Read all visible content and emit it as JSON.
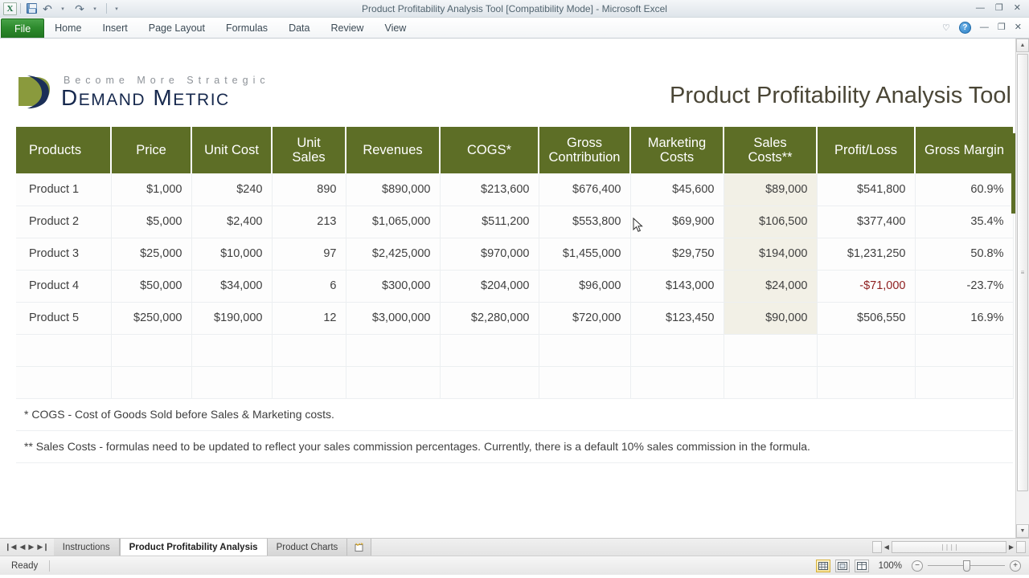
{
  "titlebar": {
    "document_title": "Product Profitability Analysis Tool  [Compatibility Mode]  -  Microsoft Excel",
    "excel_icon": "X",
    "save_icon": "save-icon",
    "undo_icon": "↶",
    "redo_icon": "↷",
    "caret": "▾",
    "minimize": "—",
    "restore": "❐",
    "close": "✕"
  },
  "ribbon": {
    "file_label": "File",
    "tabs": [
      {
        "label": "Home"
      },
      {
        "label": "Insert"
      },
      {
        "label": "Page Layout"
      },
      {
        "label": "Formulas"
      },
      {
        "label": "Data"
      },
      {
        "label": "Review"
      },
      {
        "label": "View"
      }
    ],
    "heart_icon": "♡",
    "help_icon": "?",
    "minimize_ribbon": "—",
    "restore_window": "❐",
    "close_window": "✕"
  },
  "document": {
    "logo": {
      "tagline": "Become More Strategic",
      "brand_part1": "D",
      "brand_rest1": "EMAND",
      "brand_part2": "M",
      "brand_rest2": "ETRIC",
      "mark_green": "#8a9a3d",
      "mark_navy": "#1b2f57"
    },
    "title": "Product Profitability Analysis Tool",
    "accent_green": "#5d6e26",
    "tint_cream": "#f2f0e6",
    "negative_color": "#8f2020"
  },
  "table": {
    "headers": [
      "Products",
      "Price",
      "Unit Cost",
      "Unit Sales",
      "Revenues",
      "COGS*",
      "Gross Contribution",
      "Marketing Costs",
      "Sales Costs**",
      "Profit/Loss",
      "Gross Margin"
    ],
    "rows": [
      {
        "product": "Product 1",
        "price": "$1,000",
        "unit_cost": "$240",
        "unit_sales": "890",
        "revenues": "$890,000",
        "cogs": "$213,600",
        "gross_contribution": "$676,400",
        "marketing_costs": "$45,600",
        "sales_costs": "$89,000",
        "profit_loss": "$541,800",
        "gross_margin": "60.9%",
        "negative": false
      },
      {
        "product": "Product 2",
        "price": "$5,000",
        "unit_cost": "$2,400",
        "unit_sales": "213",
        "revenues": "$1,065,000",
        "cogs": "$511,200",
        "gross_contribution": "$553,800",
        "marketing_costs": "$69,900",
        "sales_costs": "$106,500",
        "profit_loss": "$377,400",
        "gross_margin": "35.4%",
        "negative": false
      },
      {
        "product": "Product 3",
        "price": "$25,000",
        "unit_cost": "$10,000",
        "unit_sales": "97",
        "revenues": "$2,425,000",
        "cogs": "$970,000",
        "gross_contribution": "$1,455,000",
        "marketing_costs": "$29,750",
        "sales_costs": "$194,000",
        "profit_loss": "$1,231,250",
        "gross_margin": "50.8%",
        "negative": false
      },
      {
        "product": "Product 4",
        "price": "$50,000",
        "unit_cost": "$34,000",
        "unit_sales": "6",
        "revenues": "$300,000",
        "cogs": "$204,000",
        "gross_contribution": "$96,000",
        "marketing_costs": "$143,000",
        "sales_costs": "$24,000",
        "profit_loss": "-$71,000",
        "gross_margin": "-23.7%",
        "negative": true
      },
      {
        "product": "Product 5",
        "price": "$250,000",
        "unit_cost": "$190,000",
        "unit_sales": "12",
        "revenues": "$3,000,000",
        "cogs": "$2,280,000",
        "gross_contribution": "$720,000",
        "marketing_costs": "$123,450",
        "sales_costs": "$90,000",
        "profit_loss": "$506,550",
        "gross_margin": "16.9%",
        "negative": false
      }
    ],
    "empty_row_count": 2
  },
  "notes": [
    "* COGS - Cost of Goods Sold before Sales & Marketing costs.",
    "** Sales Costs - formulas need to be updated to reflect your sales commission percentages.  Currently, there is a default 10% sales commission in the formula."
  ],
  "sheet_tabs": {
    "nav_first": "❙◀",
    "nav_prev": "◀",
    "nav_next": "▶",
    "nav_last": "▶❙",
    "tabs": [
      {
        "label": "Instructions",
        "active": false
      },
      {
        "label": "Product Profitability Analysis",
        "active": true
      },
      {
        "label": "Product Charts",
        "active": false
      }
    ],
    "new_sheet_icon": "insert-worksheet-icon"
  },
  "statusbar": {
    "status": "Ready",
    "view_normal": "normal-view-icon",
    "view_page_layout": "page-layout-view-icon",
    "view_page_break": "page-break-view-icon",
    "zoom_out": "−",
    "zoom_in": "+",
    "zoom_level": "100%"
  }
}
